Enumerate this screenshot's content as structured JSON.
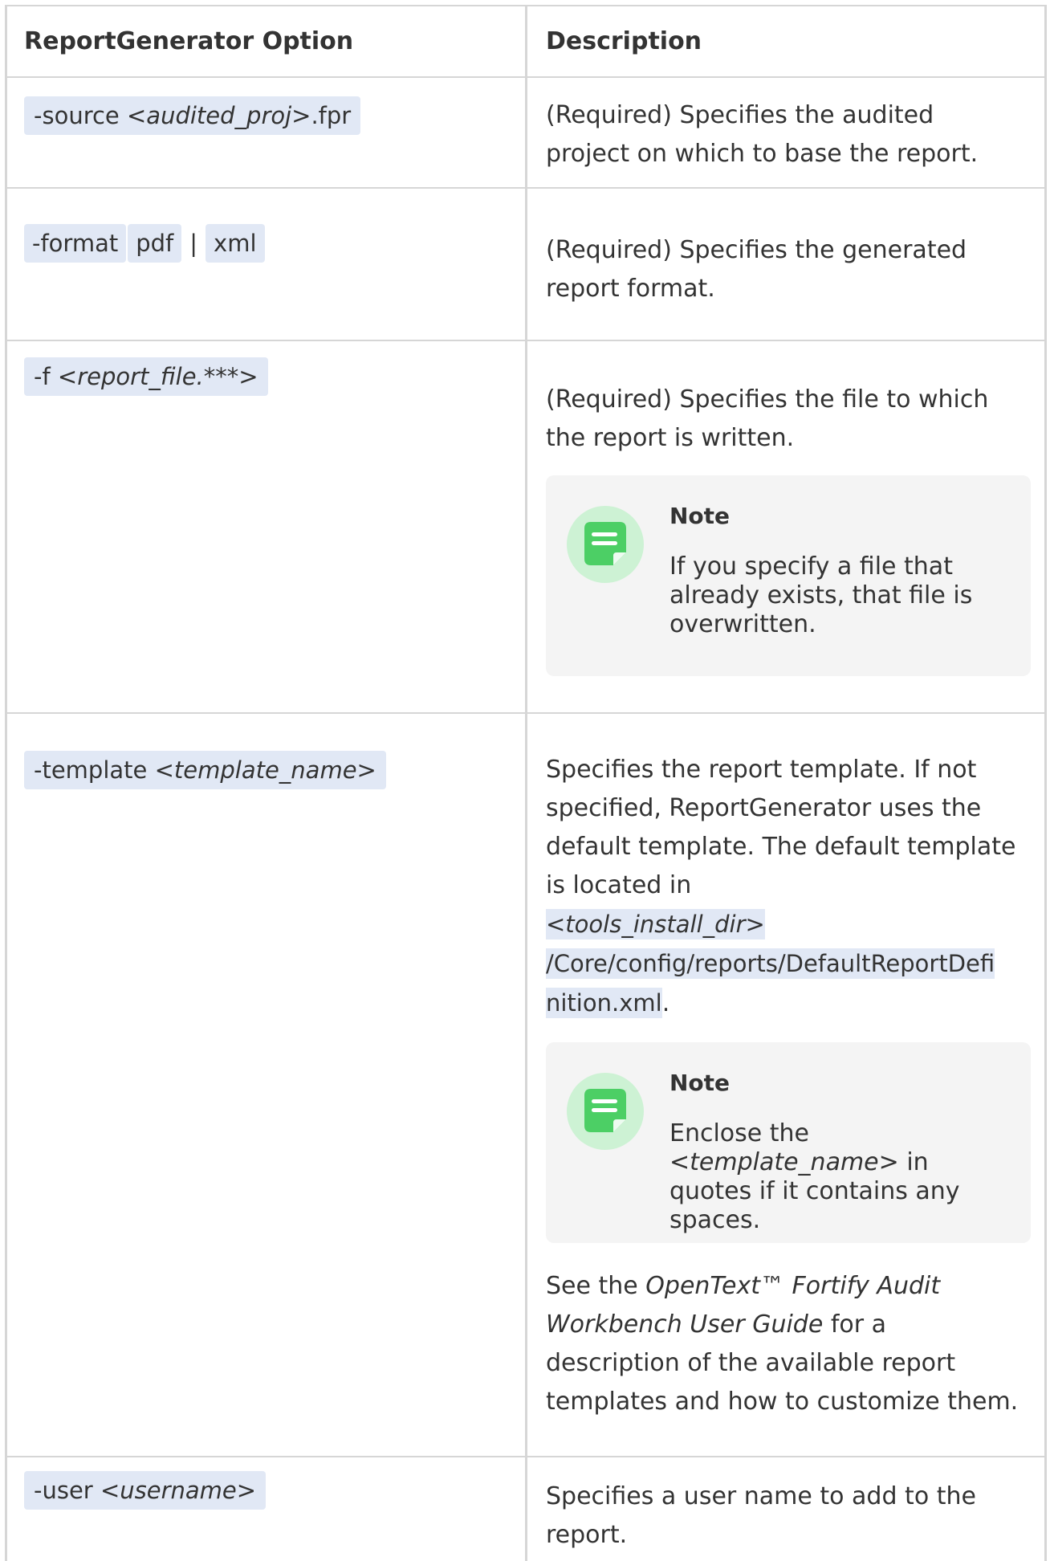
{
  "table": {
    "headers": {
      "option": "ReportGenerator Option",
      "description": "Description"
    },
    "rows": [
      {
        "option_flag": "-source",
        "option_arg": "<audited_proj>",
        "option_suffix": ".fpr",
        "description": "(Required) Specifies the audited project on which to base the report."
      },
      {
        "option_flag": "-format",
        "value_a": "pdf",
        "separator": "|",
        "value_b": "xml",
        "description": "(Required) Specifies the generated report format."
      },
      {
        "option_flag": "-f",
        "option_arg": "<report_file.***>",
        "description": "(Required) Specifies the file to which the report is written.",
        "note": {
          "title": "Note",
          "body": "If you specify a file that already exists, that file is overwritten."
        }
      },
      {
        "option_flag": "-template",
        "option_arg": "<template_name>",
        "description_intro": "Specifies the report template. If not specified, ReportGenerator uses the default template. The default template is located in",
        "path_arg": "<tools_install_dir>",
        "path_rest_1": "/Core/config/reports/DefaultReportDefi",
        "path_rest_2": "nition.xml",
        "path_end": ".",
        "note": {
          "title": "Note",
          "body_prefix": "Enclose the",
          "body_arg": "<template_name>",
          "body_suffix": "in quotes if it contains any spaces."
        },
        "see_prefix": "See the",
        "see_title_1": "OpenText™ Fortify Audit",
        "see_title_2": "Workbench User Guide",
        "see_suffix": "for a",
        "see_line_3": "description of the available report",
        "see_line_4": "templates and how to customize them."
      },
      {
        "option_flag": "-user",
        "option_arg": "<username>",
        "description": "Specifies a user name to add to the report."
      }
    ]
  },
  "icons": {
    "note": "note-icon",
    "note_color": "#4ccf65",
    "note_bg": "#cdf2d4"
  },
  "colors": {
    "code_bg": "#e1e8f5",
    "note_bg": "#f4f4f4",
    "border": "#d6d6d6",
    "text": "#333333"
  }
}
